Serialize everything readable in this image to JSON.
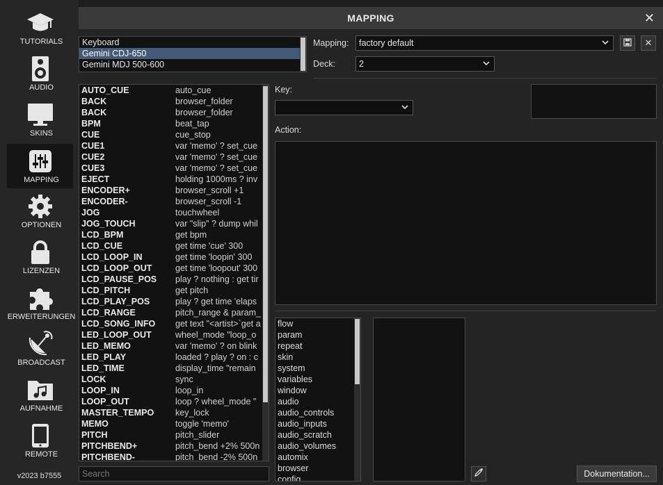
{
  "sidebar": {
    "items": [
      {
        "label": "TUTORIALS",
        "icon": "graduation-cap-icon"
      },
      {
        "label": "AUDIO",
        "icon": "speaker-icon"
      },
      {
        "label": "SKINS",
        "icon": "monitor-icon"
      },
      {
        "label": "MAPPING",
        "icon": "sliders-icon",
        "active": true
      },
      {
        "label": "OPTIONEN",
        "icon": "gear-icon"
      },
      {
        "label": "LIZENZEN",
        "icon": "lock-icon"
      },
      {
        "label": "ERWEITERUNGEN",
        "icon": "puzzle-icon"
      },
      {
        "label": "BROADCAST",
        "icon": "satellite-dish-icon"
      },
      {
        "label": "AUFNAHME",
        "icon": "music-folder-icon"
      },
      {
        "label": "REMOTE",
        "icon": "tablet-icon"
      }
    ],
    "version": "v2023 b7555"
  },
  "window": {
    "title": "MAPPING",
    "close": "✕"
  },
  "devices": {
    "items": [
      "Keyboard",
      "Gemini CDJ-650",
      "Gemini MDJ 500-600"
    ],
    "selected_index": 1
  },
  "mapping": {
    "label": "Mapping:",
    "value": "factory default"
  },
  "deck": {
    "label": "Deck:",
    "value": "2"
  },
  "key": {
    "label": "Key:",
    "value": ""
  },
  "action": {
    "label": "Action:",
    "value": ""
  },
  "keys": [
    {
      "name": "AUTO_CUE",
      "action": "auto_cue"
    },
    {
      "name": "BACK",
      "action": "browser_folder"
    },
    {
      "name": "BACK",
      "action": "browser_folder"
    },
    {
      "name": "BPM",
      "action": "beat_tap"
    },
    {
      "name": "CUE",
      "action": "cue_stop"
    },
    {
      "name": "CUE1",
      "action": "var 'memo' ? set_cue"
    },
    {
      "name": "CUE2",
      "action": "var 'memo' ? set_cue"
    },
    {
      "name": "CUE3",
      "action": "var 'memo' ? set_cue"
    },
    {
      "name": "EJECT",
      "action": "holding 1000ms ? inv"
    },
    {
      "name": "ENCODER+",
      "action": "browser_scroll +1"
    },
    {
      "name": "ENCODER-",
      "action": "browser_scroll -1"
    },
    {
      "name": "JOG",
      "action": "touchwheel"
    },
    {
      "name": "JOG_TOUCH",
      "action": "var \"slip\" ? dump whil"
    },
    {
      "name": "LCD_BPM",
      "action": "get bpm"
    },
    {
      "name": "LCD_CUE",
      "action": "get time 'cue' 300"
    },
    {
      "name": "LCD_LOOP_IN",
      "action": "get time 'loopin' 300"
    },
    {
      "name": "LCD_LOOP_OUT",
      "action": "get time 'loopout' 300"
    },
    {
      "name": "LCD_PAUSE_POS",
      "action": "play ? nothing : get tir"
    },
    {
      "name": "LCD_PITCH",
      "action": "get pitch"
    },
    {
      "name": "LCD_PLAY_POS",
      "action": "play ? get time 'elaps"
    },
    {
      "name": "LCD_RANGE",
      "action": "pitch_range & param_"
    },
    {
      "name": "LCD_SONG_INFO",
      "action": "get text \"<artist>`get a"
    },
    {
      "name": "LED_LOOP_OUT",
      "action": "wheel_mode \"loop_o"
    },
    {
      "name": "LED_MEMO",
      "action": "var 'memo' ? on blink"
    },
    {
      "name": "LED_PLAY",
      "action": "loaded ? play ? on : c"
    },
    {
      "name": "LED_TIME",
      "action": "display_time \"remain"
    },
    {
      "name": "LOCK",
      "action": "sync"
    },
    {
      "name": "LOOP_IN",
      "action": "loop_in"
    },
    {
      "name": "LOOP_OUT",
      "action": "loop ? wheel_mode \""
    },
    {
      "name": "MASTER_TEMPO",
      "action": "key_lock"
    },
    {
      "name": "MEMO",
      "action": "toggle 'memo'"
    },
    {
      "name": "PITCH",
      "action": "pitch_slider"
    },
    {
      "name": "PITCHBEND+",
      "action": "pitch_bend +2% 500n"
    },
    {
      "name": "PITCHBEND-",
      "action": "pitch_bend -2% 500n"
    }
  ],
  "search": {
    "placeholder": "Search"
  },
  "categories": [
    "flow",
    "param",
    "repeat",
    "skin",
    "system",
    "variables",
    "window",
    "audio",
    "audio_controls",
    "audio_inputs",
    "audio_scratch",
    "audio_volumes",
    "automix",
    "browser",
    "config"
  ],
  "buttons": {
    "save_icon": "save-icon",
    "delete_label": "✕",
    "picker_icon": "eyedropper-icon",
    "documentation_label": "Dokumentation..."
  },
  "colors": {
    "selection": "#445a79",
    "background": "#242424",
    "sidebar": "#262626"
  }
}
